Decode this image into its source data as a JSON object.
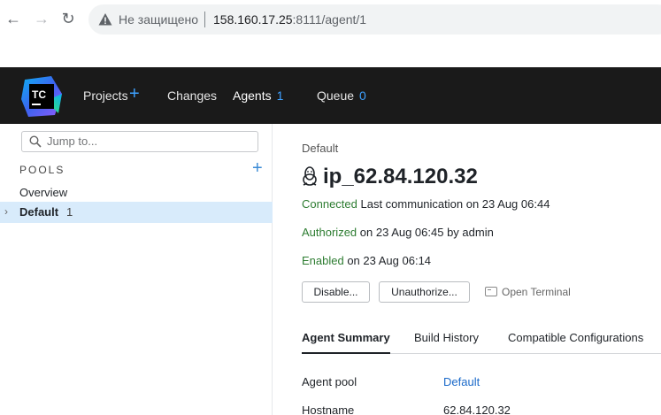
{
  "browser": {
    "insecure_label": "Не защищено",
    "url_host": "158.160.17.25",
    "url_rest": ":8111/agent/1"
  },
  "header": {
    "logo_text": "TC",
    "nav": [
      {
        "label": "Projects"
      },
      {
        "label": "Changes"
      },
      {
        "label": "Agents",
        "count": "1"
      },
      {
        "label": "Queue",
        "count": "0"
      }
    ]
  },
  "sidebar": {
    "search_placeholder": "Jump to...",
    "pools_title": "POOLS",
    "overview_label": "Overview",
    "default_label": "Default",
    "default_count": "1"
  },
  "main": {
    "breadcrumb": "Default",
    "agent_name": "ip_62.84.120.32",
    "connected_word": "Connected",
    "connected_rest": " Last communication on 23 Aug 06:44",
    "authorized_word": "Authorized",
    "authorized_rest": " on 23 Aug 06:45 by admin",
    "enabled_word": "Enabled",
    "enabled_rest": " on 23 Aug 06:14",
    "disable_button": "Disable...",
    "unauthorize_button": "Unauthorize...",
    "open_terminal": "Open Terminal",
    "tabs": [
      {
        "label": "Agent Summary"
      },
      {
        "label": "Build History"
      },
      {
        "label": "Compatible Configurations"
      }
    ],
    "props": [
      {
        "key": "Agent pool",
        "value": "Default"
      },
      {
        "key": "Hostname",
        "value": "62.84.120.32"
      }
    ]
  },
  "colors": {
    "header_bg": "#1a1a1a",
    "accent_blue": "#3ea1ff",
    "status_green": "#2e7d32",
    "selected_row": "#d8ebfb"
  }
}
